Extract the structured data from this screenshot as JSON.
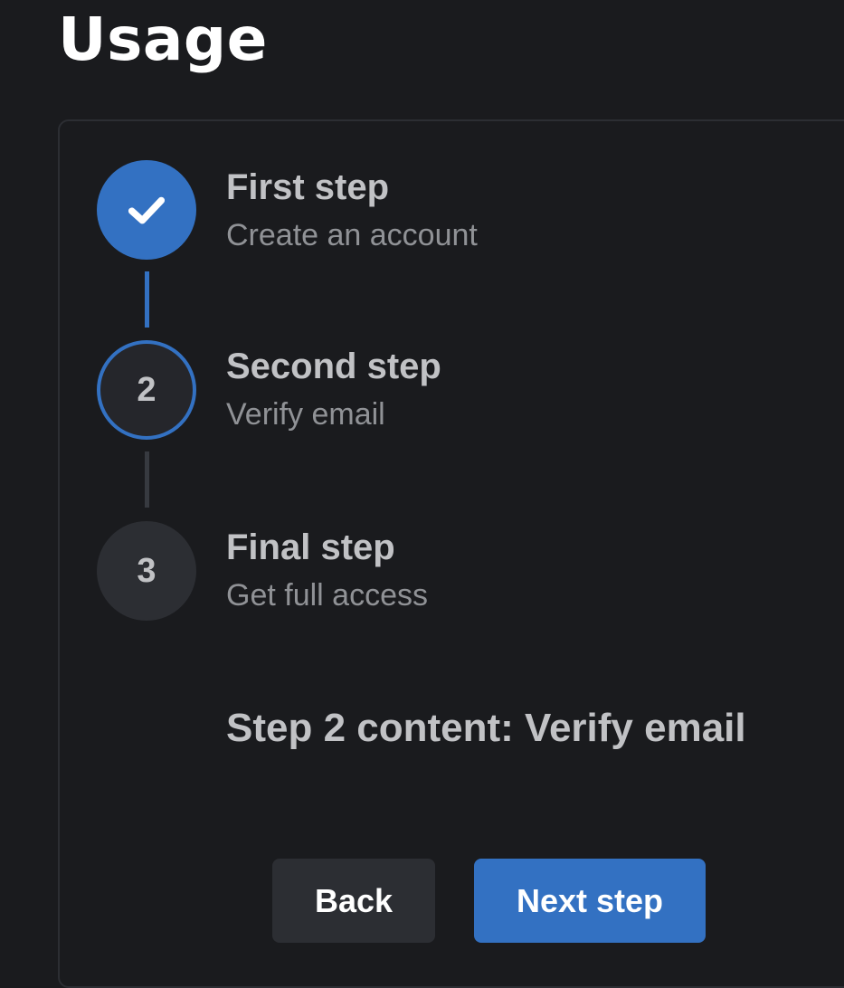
{
  "page": {
    "title": "Usage"
  },
  "stepper": {
    "active_step": 2,
    "steps": [
      {
        "label": "First step",
        "description": "Create an account",
        "status": "completed",
        "icon": "check-icon"
      },
      {
        "label": "Second step",
        "description": "Verify email",
        "status": "active",
        "number": "2"
      },
      {
        "label": "Final step",
        "description": "Get full access",
        "status": "pending",
        "number": "3"
      }
    ],
    "content": "Step 2 content: Verify email"
  },
  "actions": {
    "back_label": "Back",
    "next_label": "Next step"
  },
  "colors": {
    "background": "#1a1b1e",
    "accent": "#3371c2",
    "panel_border": "#2c2e33",
    "pending_connector": "#373a40",
    "text_primary": "#c1c2c5",
    "text_secondary": "#909296"
  }
}
